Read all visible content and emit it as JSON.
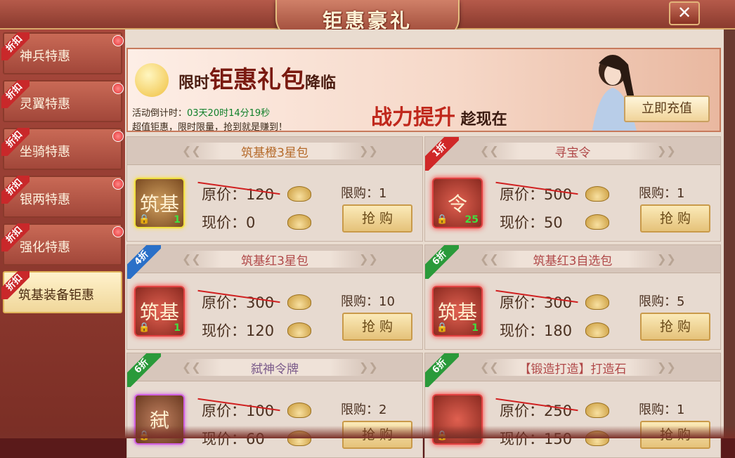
{
  "window": {
    "title": "钜惠豪礼",
    "close_label": "✕"
  },
  "sidebar": {
    "badge": "折扣",
    "items": [
      {
        "label": "神兵特惠"
      },
      {
        "label": "灵翼特惠"
      },
      {
        "label": "坐骑特惠"
      },
      {
        "label": "银两特惠"
      },
      {
        "label": "强化特惠"
      },
      {
        "label": "筑基装备钜惠"
      }
    ]
  },
  "banner": {
    "headline_small1": "限时",
    "headline_big": "钜惠礼包",
    "headline_small2": "降临",
    "countdown_label": "活动倒计时：",
    "countdown_value": "03天20时14分19秒",
    "note": "超值钜惠，限时限量，抢到就是赚到！",
    "slogan_red": "战力提升",
    "slogan_dark": " 趁现在",
    "recharge_label": "立即充值"
  },
  "labels": {
    "orig_prefix": "原价：",
    "now_prefix": "现价：",
    "limit_prefix": "限购：",
    "buy": "抢 购"
  },
  "items": [
    {
      "name": "筑基橙3星包",
      "discount": "",
      "orig": "120",
      "now": "0",
      "limit": "1",
      "qty": "1",
      "glyph": "筑基"
    },
    {
      "name": "寻宝令",
      "discount": "1折",
      "orig": "500",
      "now": "50",
      "limit": "1",
      "qty": "25",
      "glyph": "令"
    },
    {
      "name": "筑基红3星包",
      "discount": "4折",
      "orig": "300",
      "now": "120",
      "limit": "10",
      "qty": "1",
      "glyph": "筑基"
    },
    {
      "name": "筑基红3自选包",
      "discount": "6折",
      "orig": "300",
      "now": "180",
      "limit": "5",
      "qty": "1",
      "glyph": "筑基"
    },
    {
      "name": "弑神令牌",
      "discount": "6折",
      "orig": "100",
      "now": "60",
      "limit": "2",
      "qty": "",
      "glyph": "弑"
    },
    {
      "name": "【锻造打造】打造石",
      "discount": "6折",
      "orig": "250",
      "now": "150",
      "limit": "1",
      "qty": "",
      "glyph": ""
    }
  ]
}
